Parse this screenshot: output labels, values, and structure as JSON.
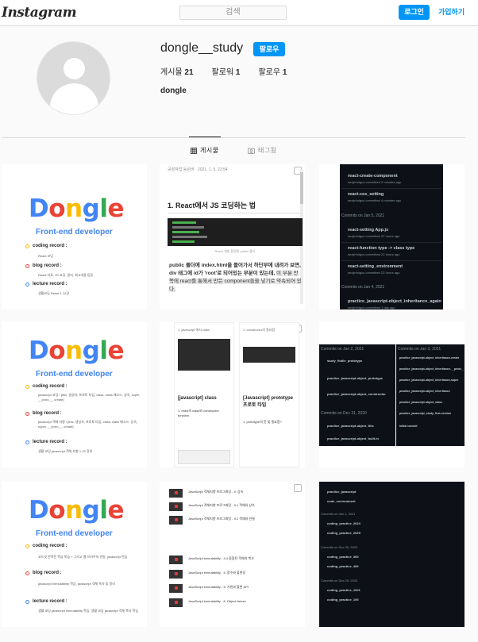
{
  "header": {
    "logo": "Instagram",
    "search_placeholder": "검색",
    "login_label": "로그인",
    "signup_label": "가입하기"
  },
  "profile": {
    "username": "dongle__study",
    "follow_label": "팔로우",
    "stats": [
      {
        "label": "게시물",
        "value": "21"
      },
      {
        "label": "팔로워",
        "value": "1"
      },
      {
        "label": "팔로우",
        "value": "1"
      }
    ],
    "full_name": "dongle"
  },
  "tabs": [
    {
      "label": "게시물",
      "active": true,
      "icon": "grid-icon"
    },
    {
      "label": "태그됨",
      "active": false,
      "icon": "tagged-icon"
    }
  ],
  "posts": {
    "cover1": {
      "title_letters": [
        "D",
        "o",
        "n",
        "g",
        "l",
        "e"
      ],
      "subtitle": "Front-end developer",
      "sections": [
        {
          "label": "coding record :",
          "sub": "React 코딩"
        },
        {
          "label": "blog record :",
          "sub": "React 자료, JS 코딩, 일지, 회고내용 등등"
        },
        {
          "label": "lecture record :",
          "sub": "생활코딩 React 1-12강"
        }
      ]
    },
    "blog1": {
      "meta": "공장작업 등원바 · 2021. 1. 5. 22:54",
      "heading": "1. React에서 JS 코딩하는 법",
      "caption": "React 개발 환경의 public 폴더",
      "body_1": " public 폴더에 index.html을 들어가서 하단부에 내려가 보면, div 태그에 id가 'root'로 되어있는 부분이 있는데, ",
      "body_2": "이 부분 안쪽에 react를 통해서 만든 component들을 넣기로 약속되어 있다."
    },
    "gh1": {
      "items": [
        {
          "title": "react-create-component",
          "by": "seojinhdgus committed 2 minutes ago"
        },
        {
          "title": "react-css_setting",
          "by": "seojinhdgus committed 4 minutes ago"
        },
        {
          "section": "Commits on Jan 5, 2021"
        },
        {
          "title": "react-setting App.js",
          "by": "seojinhdgus committed 22 hours ago"
        },
        {
          "title": "react-function type -> class type",
          "by": "seojinhdgus committed 22 hours ago"
        },
        {
          "title": "react-setting_environment",
          "by": "seojinhdgus committed 22 hours ago"
        },
        {
          "section": "Commits on Jan 4, 2021"
        },
        {
          "title": "practice_javascript-object_inheritance_again",
          "by": "seojinhdgus committed 1 day ago"
        }
      ]
    },
    "cover2": {
      "title_letters": [
        "D",
        "o",
        "n",
        "g",
        "l",
        "e"
      ],
      "subtitle": "Front-end developer",
      "sections": [
        {
          "label": "coding record :",
          "sub": "javascript 코딩 / [this, 생성자, 프로토 타입, class, class 메소드, 상속, super, __proto__, create]"
        },
        {
          "label": "blog record :",
          "sub": "javascript 객체 지향 / [this, 생성자, 프로토 타입, class, class 메소드, 상속, super, __proto__, create]"
        },
        {
          "label": "lecture record :",
          "sub": "생활 코딩 javascript 객체 지향 1-22 강의"
        }
      ]
    },
    "doc2": {
      "left_heading": "[javascript] class",
      "left_sub": "1. react의 class와 constructor function",
      "right_heading": "[Javascript] prototype 프로토 타입",
      "right_sub": "1. prototype의 뜻 및 필요함?",
      "top_left": "1. javascript 에서 class",
      "top_right": "1. constructor의 필요함"
    },
    "gh2": {
      "left": [
        "Commits on Jan 2, 2021",
        "study_fiddle_prototype",
        "practice_javascript-object_prototype",
        "practice_javascript-object_constructor",
        "Commits on Dec 31, 2020",
        "practice_javascript-object_this",
        "practice_javascript-object_built-in"
      ],
      "right": [
        "Commits on Jan 3, 2021",
        "practice_javascript-object_inheritance-create",
        "practice_javascript-object_inheritance-__proto__",
        "practice_javascript-object_inheritance-super",
        "practice_javascript-object_inheritance",
        "practice_javascript-object_class",
        "practice_javascript_study_first-version",
        "Initial commit"
      ]
    },
    "cover3": {
      "title_letters": [
        "D",
        "o",
        "n",
        "g",
        "l",
        "e"
      ],
      "subtitle": "Front-end developer",
      "sections": [
        {
          "label": "coding record :",
          "sub": "코드잇 반복문 학습 복습 + 그리고 웹 브라우저 연동, javascript 연습"
        },
        {
          "label": "blog record :",
          "sub": "javascript immutability 학습, javascript 객체 복사 및 정리"
        },
        {
          "label": "lecture record :",
          "sub": "생활 코딩 javascript immutability 학습, 생활 코딩 javascript 객체 복사 학습"
        }
      ]
    },
    "list3": {
      "rows": [
        "JavaScript 객체지향 프로그래밍 - 9. 상속",
        "JavaScript 객체지향 프로그래밍 - 9.1 객체와 상속",
        "JavaScript 객체지향 프로그래밍 - 9.2 객체와 연결",
        "JavaScript immutability - 4.4 중첩된 객체의 복사",
        "JavaScript immutability - 5. 함수와 불변성",
        "JavaScript immutability - 5. 가변과 불변 API",
        "JavaScript immutability - 6. Object freeze"
      ]
    },
    "gh3": {
      "items": [
        "practice_javascript",
        "code_environment",
        "Commits on Jan 1, 2021",
        "coding_practice_2024",
        "coding_practice_2025",
        "Commits on Dec 30, 2020",
        "coding_practice_360",
        "coding_practice_400",
        "Commits on Dec 29, 2020",
        "coding_practice_1001",
        "coding_practice_100"
      ]
    }
  }
}
